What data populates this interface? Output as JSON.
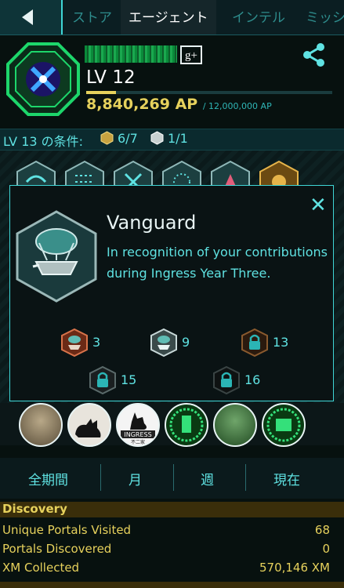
{
  "nav": {
    "tabs": [
      {
        "label": "ストア",
        "active": false
      },
      {
        "label": "エージェント",
        "active": true
      },
      {
        "label": "インテル",
        "active": false
      },
      {
        "label": "ミッシ",
        "active": false
      }
    ]
  },
  "profile": {
    "level": "LV 12",
    "ap": "8,840,269 AP",
    "ap_max": "/ 12,000,000 AP",
    "ap_progress": 0.12,
    "faction_color": "#1dd66b"
  },
  "requirements": {
    "label": "LV 13 の条件:",
    "gold": "6/7",
    "silver": "1/1"
  },
  "modal": {
    "title": "Vanguard",
    "description": "In recognition of your contributions during Ingress Year Three.",
    "close_icon": "close-icon",
    "tiers": [
      "3",
      "9",
      "13",
      "15",
      "16"
    ]
  },
  "medal_text": {
    "ingress": "INGRESS",
    "sub": "不二家"
  },
  "periods": [
    "全期間",
    "月",
    "週",
    "現在"
  ],
  "stats": {
    "section": "Discovery",
    "rows": [
      {
        "label": "Unique Portals Visited",
        "value": "68"
      },
      {
        "label": "Portals Discovered",
        "value": "0"
      },
      {
        "label": "XM Collected",
        "value": "570,146 XM"
      }
    ]
  },
  "colors": {
    "accent": "#5fe2e2",
    "gold": "#e6d15c",
    "bronze": "#b5542e",
    "green": "#1dd66b"
  }
}
